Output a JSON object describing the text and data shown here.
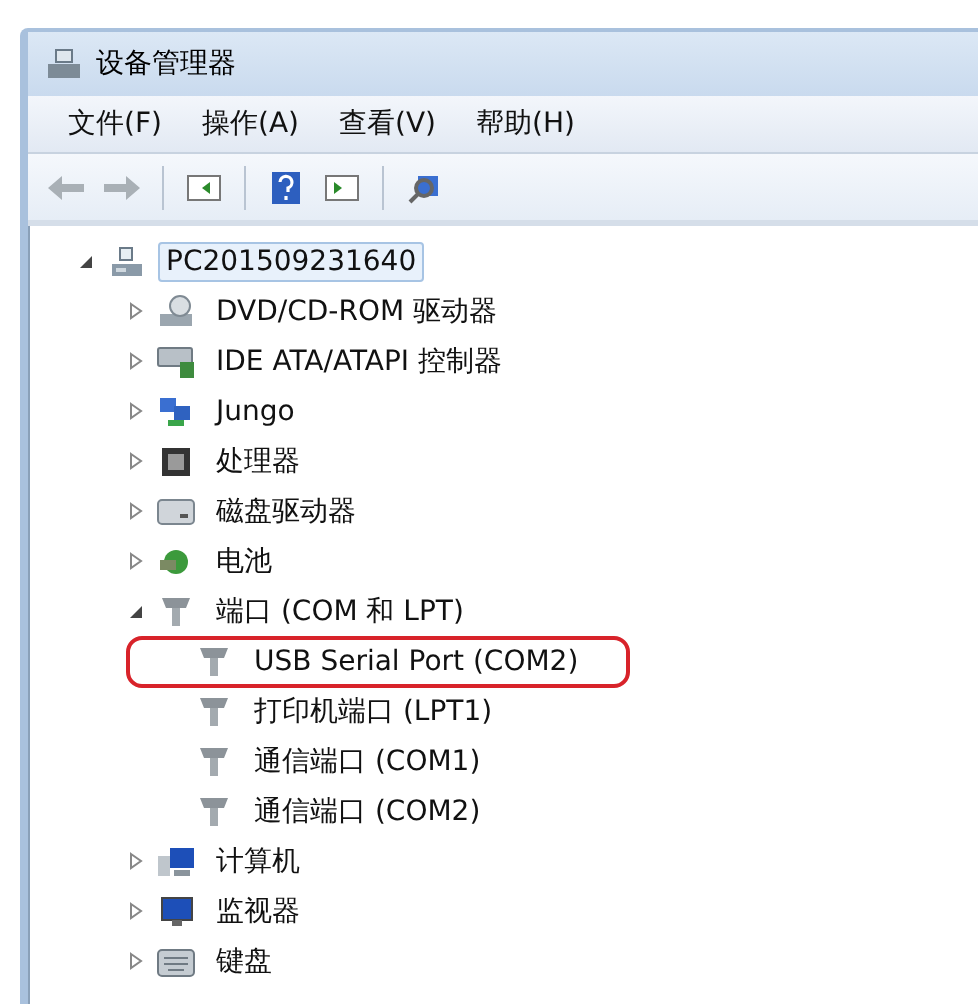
{
  "window": {
    "title": "设备管理器"
  },
  "menu": [
    "文件(F)",
    "操作(A)",
    "查看(V)",
    "帮助(H)"
  ],
  "tree": {
    "label": "PC201509231640",
    "selected": true,
    "expanded": true,
    "children": [
      {
        "label": "DVD/CD-ROM 驱动器",
        "selected": false,
        "expanded": false
      },
      {
        "label": "IDE ATA/ATAPI 控制器",
        "selected": false,
        "expanded": false
      },
      {
        "label": "Jungo",
        "selected": false,
        "expanded": false
      },
      {
        "label": "处理器",
        "selected": false,
        "expanded": false
      },
      {
        "label": "磁盘驱动器",
        "selected": false,
        "expanded": false
      },
      {
        "label": "电池",
        "selected": false,
        "expanded": false
      },
      {
        "label": "端口 (COM 和 LPT)",
        "selected": false,
        "expanded": true,
        "children": [
          {
            "label": "USB Serial Port (COM2)",
            "selected": false,
            "circled": true
          },
          {
            "label": "打印机端口 (LPT1)",
            "selected": false,
            "circled": false
          },
          {
            "label": "通信端口 (COM1)",
            "selected": false,
            "circled": false
          },
          {
            "label": "通信端口 (COM2)",
            "selected": false,
            "circled": false
          }
        ]
      },
      {
        "label": "计算机",
        "selected": false,
        "expanded": false
      },
      {
        "label": "监视器",
        "selected": false,
        "expanded": false
      },
      {
        "label": "键盘",
        "selected": false,
        "expanded": false
      }
    ]
  }
}
